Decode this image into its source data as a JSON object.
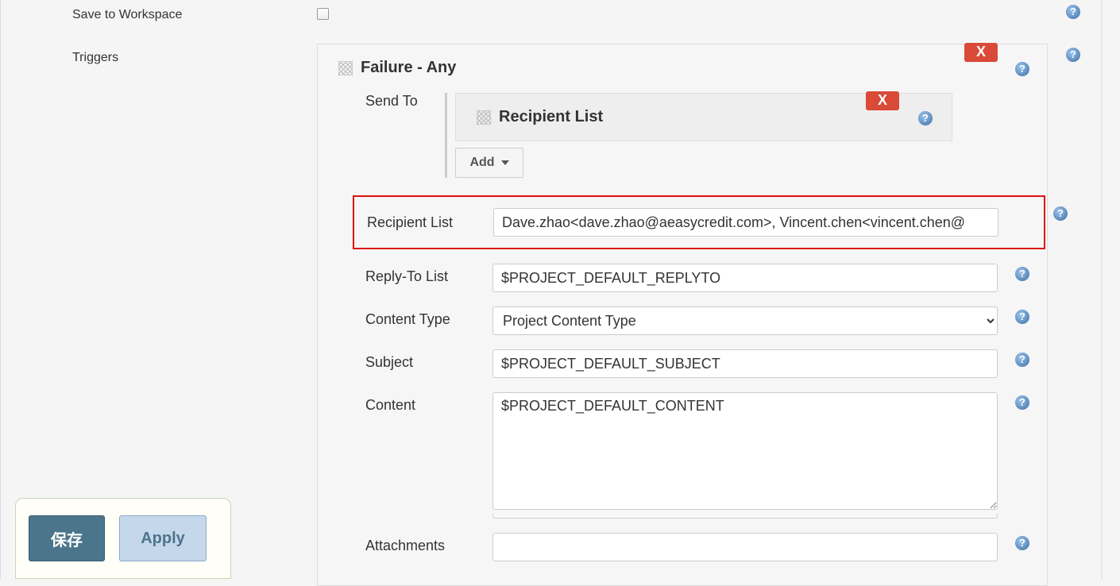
{
  "sidebar": {
    "save_to_workspace": "Save to Workspace",
    "triggers": "Triggers"
  },
  "trigger": {
    "title": "Failure - Any",
    "close_label": "X",
    "send_to_label": "Send To",
    "recipient_card_title": "Recipient List",
    "recipient_close_label": "X",
    "add_label": "Add"
  },
  "fields": {
    "recipient_list": {
      "label": "Recipient List",
      "value": "Dave.zhao<dave.zhao@aeasycredit.com>, Vincent.chen<vincent.chen@"
    },
    "reply_to": {
      "label": "Reply-To List",
      "value": "$PROJECT_DEFAULT_REPLYTO"
    },
    "content_type": {
      "label": "Content Type",
      "value": "Project Content Type"
    },
    "subject": {
      "label": "Subject",
      "value": "$PROJECT_DEFAULT_SUBJECT"
    },
    "content": {
      "label": "Content",
      "value": "$PROJECT_DEFAULT_CONTENT"
    },
    "attachments": {
      "label": "Attachments",
      "value": ""
    }
  },
  "footer": {
    "save": "保存",
    "apply": "Apply"
  }
}
